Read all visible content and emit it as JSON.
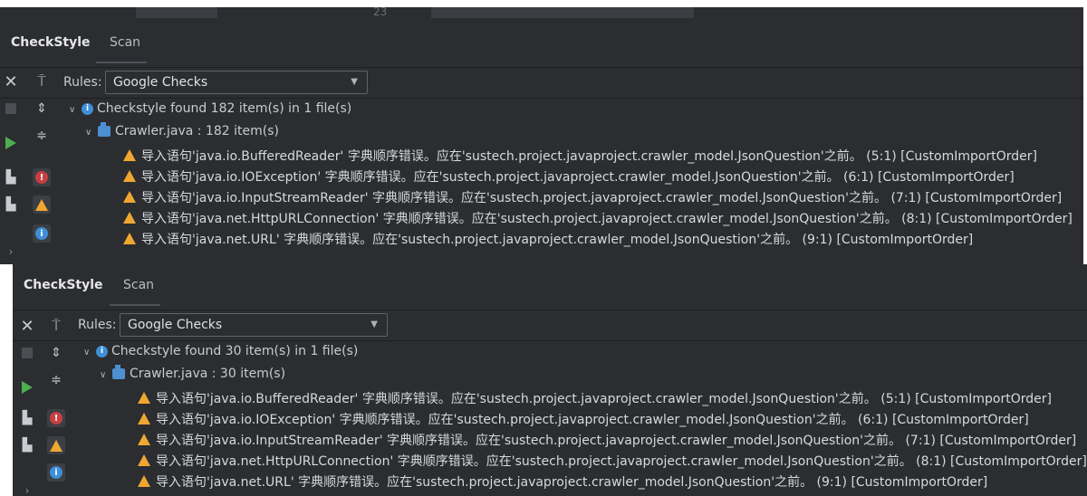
{
  "panels": [
    {
      "topstrip": {
        "line_number": "23"
      },
      "tabs": {
        "active": "CheckStyle",
        "scan": "Scan"
      },
      "toolbar": {
        "rules_label": "Rules:",
        "rules_value": "Google Checks"
      },
      "summary": "Checkstyle found 182 item(s) in 1 file(s)",
      "file": "Crawler.java : 182 item(s)",
      "rows": [
        "导入语句'java.io.BufferedReader' 字典顺序错误。应在'sustech.project.javaproject.crawler_model.JsonQuestion'之前。 (5:1) [CustomImportOrder]",
        "导入语句'java.io.IOException' 字典顺序错误。应在'sustech.project.javaproject.crawler_model.JsonQuestion'之前。 (6:1) [CustomImportOrder]",
        "导入语句'java.io.InputStreamReader' 字典顺序错误。应在'sustech.project.javaproject.crawler_model.JsonQuestion'之前。 (7:1) [CustomImportOrder]",
        "导入语句'java.net.HttpURLConnection' 字典顺序错误。应在'sustech.project.javaproject.crawler_model.JsonQuestion'之前。 (8:1) [CustomImportOrder]",
        "导入语句'java.net.URL' 字典顺序错误。应在'sustech.project.javaproject.crawler_model.JsonQuestion'之前。 (9:1) [CustomImportOrder]"
      ]
    },
    {
      "tabs": {
        "active": "CheckStyle",
        "scan": "Scan"
      },
      "toolbar": {
        "rules_label": "Rules:",
        "rules_value": "Google Checks"
      },
      "summary": "Checkstyle found 30 item(s) in 1 file(s)",
      "file": "Crawler.java : 30 item(s)",
      "rows": [
        "导入语句'java.io.BufferedReader' 字典顺序错误。应在'sustech.project.javaproject.crawler_model.JsonQuestion'之前。 (5:1) [CustomImportOrder]",
        "导入语句'java.io.IOException' 字典顺序错误。应在'sustech.project.javaproject.crawler_model.JsonQuestion'之前。 (6:1) [CustomImportOrder]",
        "导入语句'java.io.InputStreamReader' 字典顺序错误。应在'sustech.project.javaproject.crawler_model.JsonQuestion'之前。 (7:1) [CustomImportOrder]",
        "导入语句'java.net.HttpURLConnection' 字典顺序错误。应在'sustech.project.javaproject.crawler_model.JsonQuestion'之前。 (8:1) [CustomImportOrder]",
        "导入语句'java.net.URL' 字典顺序错误。应在'sustech.project.javaproject.crawler_model.JsonQuestion'之前。 (9:1) [CustomImportOrder]"
      ]
    }
  ],
  "icons": {
    "close": "close-icon",
    "pin": "pin-icon",
    "stop": "stop-icon",
    "run": "run-icon",
    "expand": "expand-all-icon",
    "collapse": "collapse-all-icon",
    "module": "module-icon",
    "error": "error-filter-icon",
    "warning": "warning-filter-icon",
    "info": "info-filter-icon",
    "more": "chevron-right-icon"
  },
  "colors": {
    "background": "#2b2d30",
    "warning": "#f0a732",
    "info": "#3f8fd8",
    "error": "#c73f43",
    "run": "#4caf50"
  }
}
